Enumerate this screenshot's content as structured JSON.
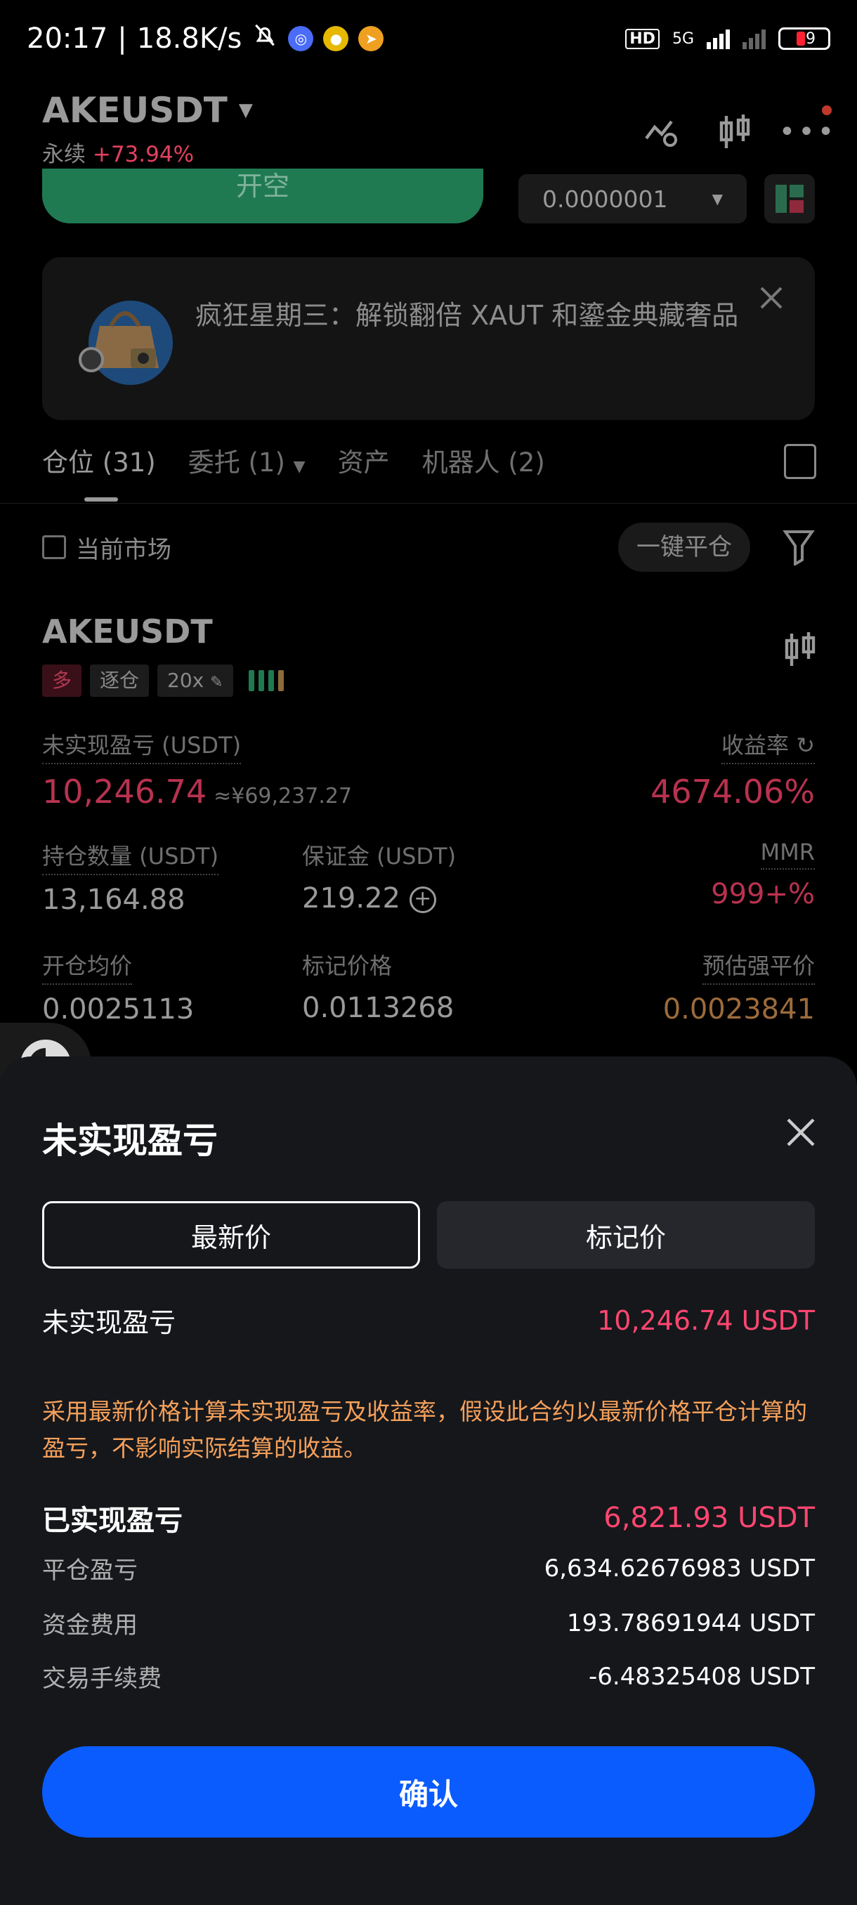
{
  "status_bar": {
    "time": "20:17",
    "net_speed": "18.8K/s",
    "hd": "HD",
    "network": "5G",
    "battery": "19"
  },
  "header": {
    "pair": "AKEUSDT",
    "contract_type": "永续",
    "change": "+73.94%"
  },
  "order_bar": {
    "open_label": "开空",
    "tick_size": "0.0000001"
  },
  "banner": {
    "text": "疯狂星期三：解锁翻倍 XAUT 和鎏金典藏奢品"
  },
  "tabs": [
    {
      "label": "仓位 (31)"
    },
    {
      "label": "委托 (1)"
    },
    {
      "label": "资产"
    },
    {
      "label": "机器人 (2)"
    }
  ],
  "filter": {
    "current_market": "当前市场",
    "close_all": "一键平仓"
  },
  "position": {
    "symbol": "AKEUSDT",
    "side": "多",
    "margin_mode": "逐仓",
    "leverage": "20x",
    "unrealized_label": "未实现盈亏 (USDT)",
    "unrealized_value": "10,246.74",
    "unrealized_cny": "≈¥69,237.27",
    "roe_label": "收益率",
    "roe_value": "4674.06%",
    "size_label": "持仓数量 (USDT)",
    "size_value": "13,164.88",
    "margin_label": "保证金 (USDT)",
    "margin_value": "219.22",
    "mmr_label": "MMR",
    "mmr_value": "999+%",
    "entry_label": "开仓均价",
    "entry_value": "0.0025113",
    "mark_label": "标记价格",
    "mark_value": "0.0113268",
    "liq_label": "预估强平价",
    "liq_value": "0.0023841"
  },
  "sheet": {
    "title": "未实现盈亏",
    "tab_latest": "最新价",
    "tab_mark": "标记价",
    "unrealized_label": "未实现盈亏",
    "unrealized_value": "10,246.74 USDT",
    "note": "采用最新价格计算未实现盈亏及收益率，假设此合约以最新价格平仓计算的盈亏，不影响实际结算的收益。",
    "realized_label": "已实现盈亏",
    "realized_value": "6,821.93 USDT",
    "close_pnl_label": "平仓盈亏",
    "close_pnl_value": "6,634.62676983 USDT",
    "funding_label": "资金费用",
    "funding_value": "193.78691944 USDT",
    "fee_label": "交易手续费",
    "fee_value": "-6.48325408 USDT",
    "confirm": "确认"
  }
}
